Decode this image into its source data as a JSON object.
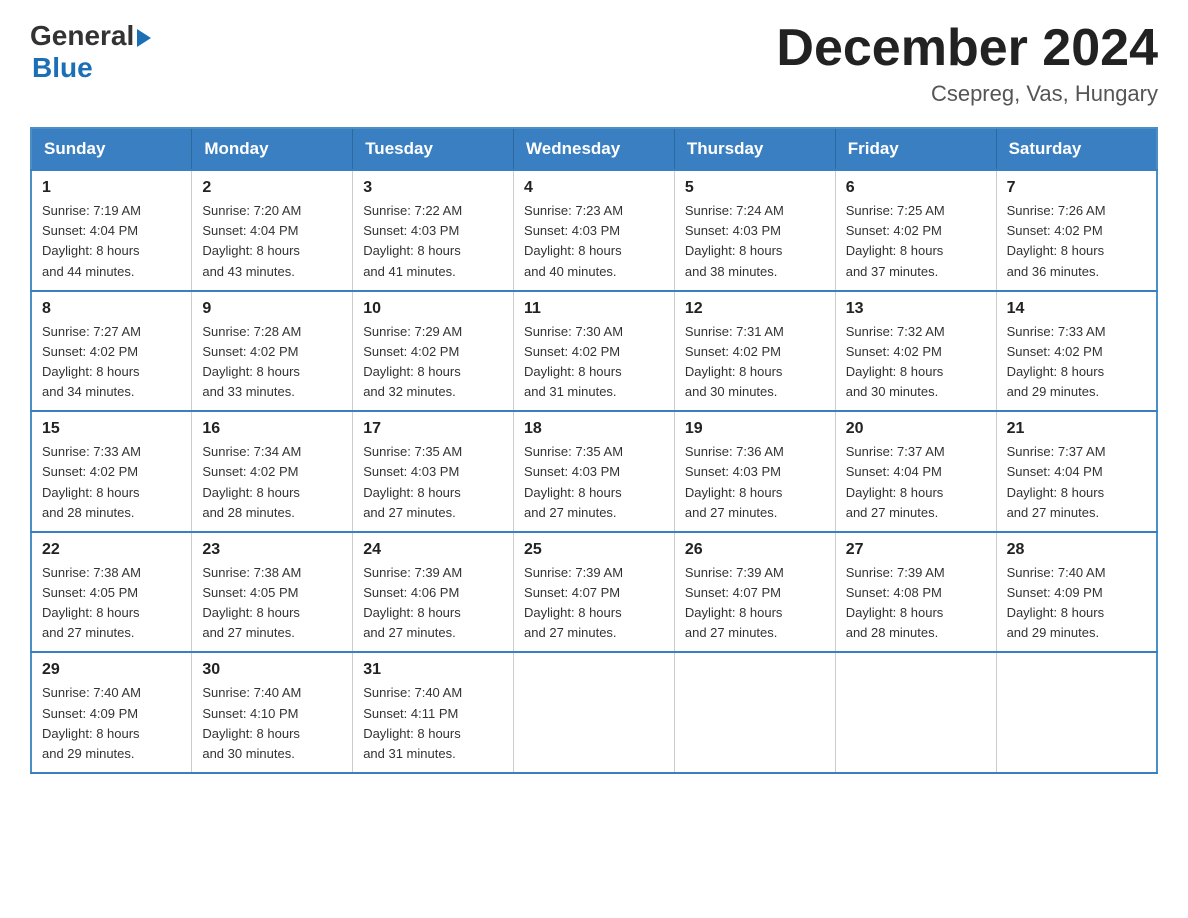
{
  "header": {
    "logo_general": "General",
    "logo_blue": "Blue",
    "month_title": "December 2024",
    "location": "Csepreg, Vas, Hungary"
  },
  "days_of_week": [
    "Sunday",
    "Monday",
    "Tuesday",
    "Wednesday",
    "Thursday",
    "Friday",
    "Saturday"
  ],
  "weeks": [
    [
      {
        "day": "1",
        "sunrise": "7:19 AM",
        "sunset": "4:04 PM",
        "daylight": "8 hours and 44 minutes."
      },
      {
        "day": "2",
        "sunrise": "7:20 AM",
        "sunset": "4:04 PM",
        "daylight": "8 hours and 43 minutes."
      },
      {
        "day": "3",
        "sunrise": "7:22 AM",
        "sunset": "4:03 PM",
        "daylight": "8 hours and 41 minutes."
      },
      {
        "day": "4",
        "sunrise": "7:23 AM",
        "sunset": "4:03 PM",
        "daylight": "8 hours and 40 minutes."
      },
      {
        "day": "5",
        "sunrise": "7:24 AM",
        "sunset": "4:03 PM",
        "daylight": "8 hours and 38 minutes."
      },
      {
        "day": "6",
        "sunrise": "7:25 AM",
        "sunset": "4:02 PM",
        "daylight": "8 hours and 37 minutes."
      },
      {
        "day": "7",
        "sunrise": "7:26 AM",
        "sunset": "4:02 PM",
        "daylight": "8 hours and 36 minutes."
      }
    ],
    [
      {
        "day": "8",
        "sunrise": "7:27 AM",
        "sunset": "4:02 PM",
        "daylight": "8 hours and 34 minutes."
      },
      {
        "day": "9",
        "sunrise": "7:28 AM",
        "sunset": "4:02 PM",
        "daylight": "8 hours and 33 minutes."
      },
      {
        "day": "10",
        "sunrise": "7:29 AM",
        "sunset": "4:02 PM",
        "daylight": "8 hours and 32 minutes."
      },
      {
        "day": "11",
        "sunrise": "7:30 AM",
        "sunset": "4:02 PM",
        "daylight": "8 hours and 31 minutes."
      },
      {
        "day": "12",
        "sunrise": "7:31 AM",
        "sunset": "4:02 PM",
        "daylight": "8 hours and 30 minutes."
      },
      {
        "day": "13",
        "sunrise": "7:32 AM",
        "sunset": "4:02 PM",
        "daylight": "8 hours and 30 minutes."
      },
      {
        "day": "14",
        "sunrise": "7:33 AM",
        "sunset": "4:02 PM",
        "daylight": "8 hours and 29 minutes."
      }
    ],
    [
      {
        "day": "15",
        "sunrise": "7:33 AM",
        "sunset": "4:02 PM",
        "daylight": "8 hours and 28 minutes."
      },
      {
        "day": "16",
        "sunrise": "7:34 AM",
        "sunset": "4:02 PM",
        "daylight": "8 hours and 28 minutes."
      },
      {
        "day": "17",
        "sunrise": "7:35 AM",
        "sunset": "4:03 PM",
        "daylight": "8 hours and 27 minutes."
      },
      {
        "day": "18",
        "sunrise": "7:35 AM",
        "sunset": "4:03 PM",
        "daylight": "8 hours and 27 minutes."
      },
      {
        "day": "19",
        "sunrise": "7:36 AM",
        "sunset": "4:03 PM",
        "daylight": "8 hours and 27 minutes."
      },
      {
        "day": "20",
        "sunrise": "7:37 AM",
        "sunset": "4:04 PM",
        "daylight": "8 hours and 27 minutes."
      },
      {
        "day": "21",
        "sunrise": "7:37 AM",
        "sunset": "4:04 PM",
        "daylight": "8 hours and 27 minutes."
      }
    ],
    [
      {
        "day": "22",
        "sunrise": "7:38 AM",
        "sunset": "4:05 PM",
        "daylight": "8 hours and 27 minutes."
      },
      {
        "day": "23",
        "sunrise": "7:38 AM",
        "sunset": "4:05 PM",
        "daylight": "8 hours and 27 minutes."
      },
      {
        "day": "24",
        "sunrise": "7:39 AM",
        "sunset": "4:06 PM",
        "daylight": "8 hours and 27 minutes."
      },
      {
        "day": "25",
        "sunrise": "7:39 AM",
        "sunset": "4:07 PM",
        "daylight": "8 hours and 27 minutes."
      },
      {
        "day": "26",
        "sunrise": "7:39 AM",
        "sunset": "4:07 PM",
        "daylight": "8 hours and 27 minutes."
      },
      {
        "day": "27",
        "sunrise": "7:39 AM",
        "sunset": "4:08 PM",
        "daylight": "8 hours and 28 minutes."
      },
      {
        "day": "28",
        "sunrise": "7:40 AM",
        "sunset": "4:09 PM",
        "daylight": "8 hours and 29 minutes."
      }
    ],
    [
      {
        "day": "29",
        "sunrise": "7:40 AM",
        "sunset": "4:09 PM",
        "daylight": "8 hours and 29 minutes."
      },
      {
        "day": "30",
        "sunrise": "7:40 AM",
        "sunset": "4:10 PM",
        "daylight": "8 hours and 30 minutes."
      },
      {
        "day": "31",
        "sunrise": "7:40 AM",
        "sunset": "4:11 PM",
        "daylight": "8 hours and 31 minutes."
      },
      null,
      null,
      null,
      null
    ]
  ],
  "labels": {
    "sunrise": "Sunrise: ",
    "sunset": "Sunset: ",
    "daylight": "Daylight: "
  }
}
